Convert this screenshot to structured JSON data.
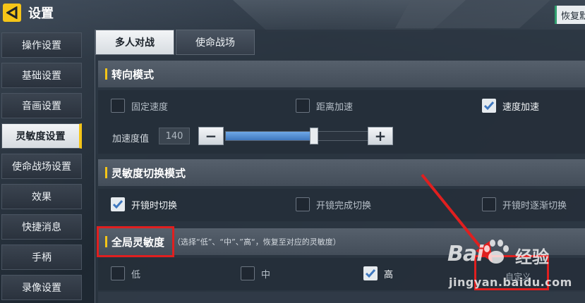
{
  "header": {
    "title": "设置",
    "restore_label": "恢复默"
  },
  "sidebar": {
    "items": [
      {
        "label": "操作设置"
      },
      {
        "label": "基础设置"
      },
      {
        "label": "音画设置"
      },
      {
        "label": "灵敏度设置"
      },
      {
        "label": "使命战场设置"
      },
      {
        "label": "效果"
      },
      {
        "label": "快捷消息"
      },
      {
        "label": "手柄"
      },
      {
        "label": "录像设置"
      }
    ],
    "active": "灵敏度设置"
  },
  "tabs": [
    {
      "label": "多人对战"
    },
    {
      "label": "使命战场"
    }
  ],
  "active_tab": "多人对战",
  "turn_mode": {
    "title": "转向模式",
    "options": [
      {
        "label": "固定速度",
        "checked": false
      },
      {
        "label": "距离加速",
        "checked": false
      },
      {
        "label": "速度加速",
        "checked": true
      }
    ],
    "accel_label": "加速度值",
    "accel_value": "140",
    "accel_level": 0.62,
    "minus": "−",
    "plus": "+"
  },
  "switch_mode": {
    "title": "灵敏度切换模式",
    "options": [
      {
        "label": "开镜时切换",
        "checked": true
      },
      {
        "label": "开镜完成切换",
        "checked": false
      },
      {
        "label": "开镜时逐渐切换",
        "checked": false
      }
    ]
  },
  "global_sens": {
    "title": "全局灵敏度",
    "hint": "（选择“低”、“中”、”高“，恢复至对应的灵敏度）",
    "options": [
      {
        "label": "低",
        "checked": false
      },
      {
        "label": "中",
        "checked": false
      },
      {
        "label": "高",
        "checked": true
      }
    ],
    "custom_label": "自定义"
  },
  "watermark": {
    "logo": "Bai",
    "cn": "经验",
    "url": "jingyan.baidu.com"
  },
  "colors": {
    "accent": "#f5c518",
    "annotation": "#e01f1f",
    "check": "#3f78bf"
  }
}
